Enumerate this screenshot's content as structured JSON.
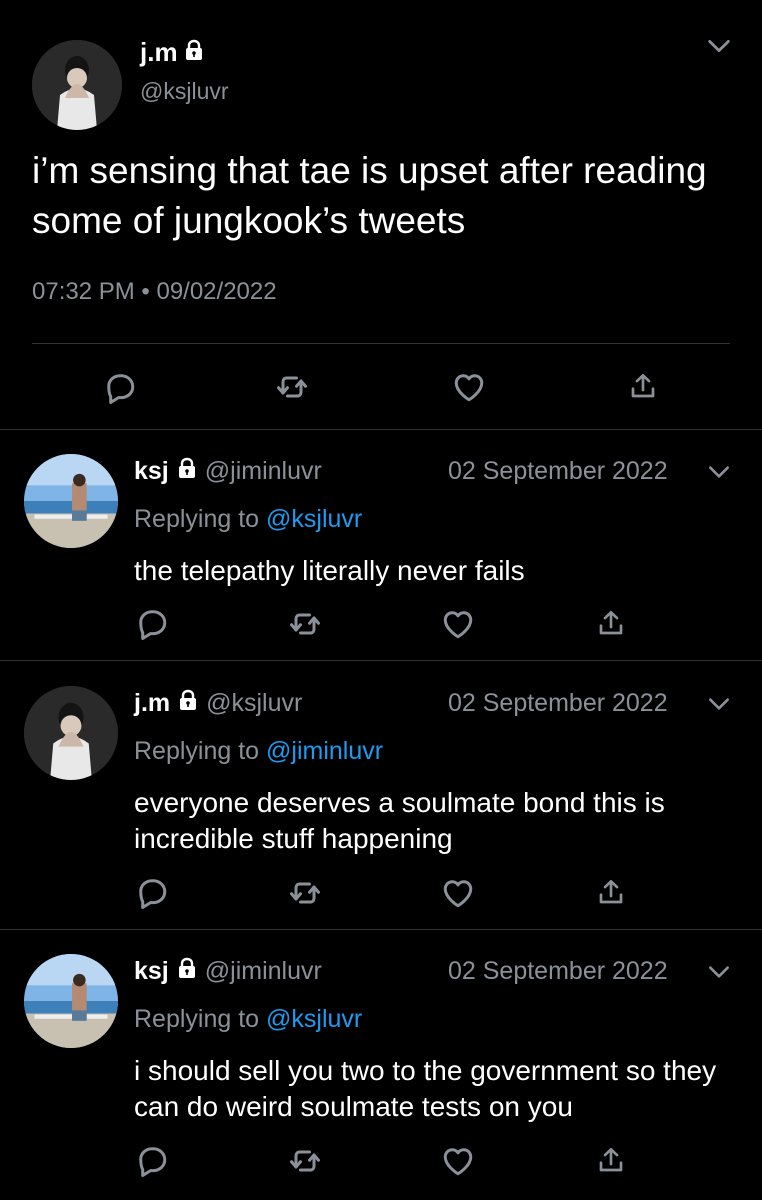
{
  "main_tweet": {
    "display_name": "j.m",
    "handle": "@ksjluvr",
    "text": "i’m sensing that tae is upset after reading some of jungkook’s tweets",
    "timestamp": "07:32 PM • 09/02/2022",
    "locked": true
  },
  "replies": [
    {
      "display_name": "ksj",
      "handle": "@jiminluvr",
      "date": "02 September 2022",
      "replying_label": "Replying to",
      "replying_to": "@ksjluvr",
      "text": "the telepathy literally never fails",
      "avatar": "beach-photo"
    },
    {
      "display_name": "j.m",
      "handle": "@ksjluvr",
      "date": "02 September 2022",
      "replying_label": "Replying to",
      "replying_to": "@jiminluvr",
      "text": "everyone deserves a soulmate bond this is incredible stuff happening",
      "avatar": "person-photo"
    },
    {
      "display_name": "ksj",
      "handle": "@jiminluvr",
      "date": "02 September 2022",
      "replying_label": "Replying to",
      "replying_to": "@ksjluvr",
      "text": "i should sell you two to the government so they can do weird soulmate tests on you",
      "avatar": "beach-photo"
    }
  ],
  "action_icons": [
    "reply-icon",
    "retweet-icon",
    "like-icon",
    "share-icon"
  ],
  "colors": {
    "background": "#000000",
    "text": "#ffffff",
    "muted": "#8b9199",
    "link": "#1d9bf0",
    "divider": "#2f3336"
  }
}
